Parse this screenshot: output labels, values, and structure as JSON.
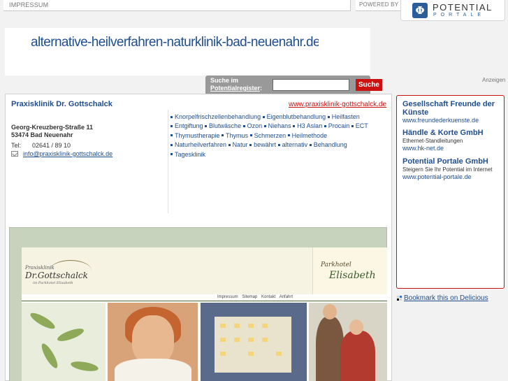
{
  "topbar": {
    "impressum": "IMPRESSUM",
    "powered_by": "POWERED BY",
    "logo_line1": "POTENTIAL",
    "logo_line2": "PORTALE",
    "logo_mark": "Φ"
  },
  "banner": {
    "domain": "alternative-heilverfahren-naturklinik-bad-neuenahr.de"
  },
  "search": {
    "label_line1": "Suche im",
    "label_line2": "Potentialregister",
    "label_colon": ":",
    "button": "Suche",
    "input_value": ""
  },
  "ads_label": "Anzeigen",
  "clinic": {
    "name": "Praxisklinik Dr. Gottschalck",
    "url": "www.praxisklinik-gottschalck.de",
    "street": "Georg-Kreuzberg-Straße 11",
    "city": "53474 Bad Neuenahr",
    "tel_label": "Tel:",
    "tel": "02641 / 89 10",
    "email": "info@praxisklinik-gottschalck.de"
  },
  "tags": [
    "Knorpelfrischzellenbehandlung",
    "Eigenblutbehandlung",
    "Heilfasten",
    "Entgiftung",
    "Blutwäsche",
    "Ozon",
    "Niehans",
    "H3 Aslan",
    "Procain",
    "ECT",
    "Thymustherapie",
    "Thymus",
    "Schmerzen",
    "Heilmethode",
    "Naturheilverfahren",
    "Natur",
    "bewährt",
    "alternativ",
    "Behandlung",
    "Tagesklinik"
  ],
  "screenshot": {
    "logo_small": "Praxisklinik",
    "logo_main": "Dr.Gottschalck",
    "logo_sub": "im Parkhotel Elisabeth",
    "park_line1": "Parkhotel",
    "park_line2": "Elisabeth",
    "nav": "Impressum Sitemap Kontakt Anfahrt"
  },
  "sidebar": {
    "ads": [
      {
        "title": "Gesellschaft Freunde der Künste",
        "desc": "",
        "url": "www.freundederkuenste.de"
      },
      {
        "title": "Händle & Korte GmbH",
        "desc": "Ethernet-Standleitungen",
        "url": "www.hk-net.de"
      },
      {
        "title": "Potential Portale GmbH",
        "desc": "Steigern Sie Ihr Potential im Internet",
        "url": "www.potential-portale.de"
      }
    ]
  },
  "bookmark": "Bookmark this on Delicious",
  "colors": {
    "link_blue": "#1f4e8f",
    "accent_red": "#cc1111",
    "search_bar_grey": "#999999"
  }
}
